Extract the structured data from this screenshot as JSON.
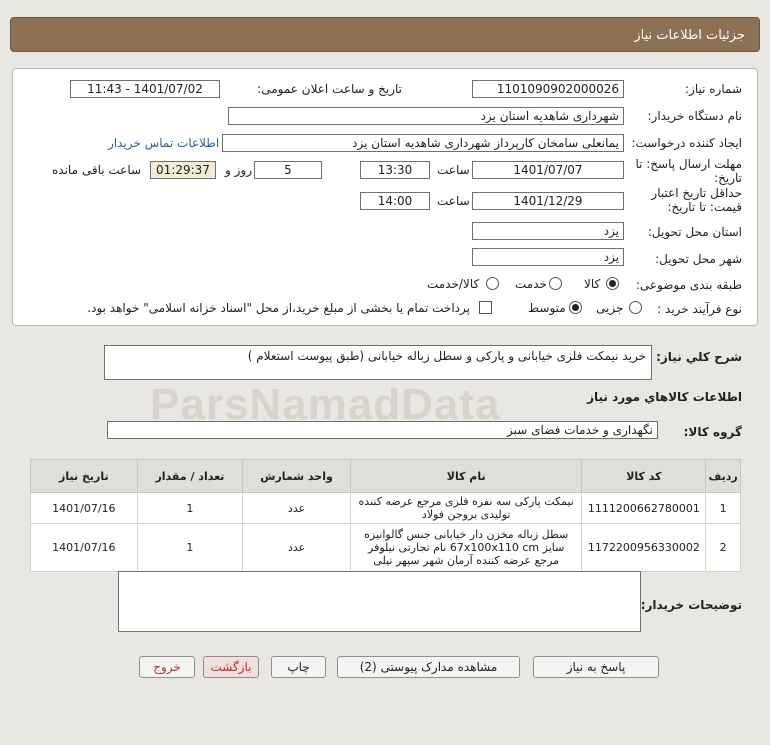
{
  "header": {
    "title": "جزئیات اطلاعات نیاز"
  },
  "form": {
    "need_number_label": "شماره نیاز:",
    "need_number": "1101090902000026",
    "announce_label": "تاریخ و ساعت اعلان عمومی:",
    "announce_value": "1401/07/02 - 11:43",
    "buyer_org_label": "نام دستگاه خریدار:",
    "buyer_org": "شهرداری شاهدیه استان یزد",
    "requester_label": "ایجاد کننده درخواست:",
    "requester": "یمانعلی سامخان کارپرداز شهرداری شاهدیه استان یزد",
    "contact_link": "اطلاعات تماس خریدار",
    "reply_deadline_label": "مهلت ارسال پاسخ: تا تاریخ:",
    "reply_date": "1401/07/07",
    "time_label": "ساعت",
    "reply_time": "13:30",
    "days": "5",
    "days_label": "روز و",
    "remaining_time": "01:29:37",
    "remaining_label": "ساعت باقی مانده",
    "min_validity_label": "حداقل تاریخ اعتبار قیمت: تا تاریخ:",
    "validity_date": "1401/12/29",
    "validity_time_label": "ساعت",
    "validity_time": "14:00",
    "delivery_province_label": "استان محل تحویل:",
    "delivery_province": "یزد",
    "delivery_city_label": "شهر محل تحویل:",
    "delivery_city": "یزد",
    "category_label": "طبقه بندی موضوعی:",
    "category_options": [
      "کالا",
      "خدمت",
      "کالا/خدمت"
    ],
    "purchase_type_label": "نوع فرآیند خرید :",
    "purchase_options": [
      "جزیی",
      "متوسط"
    ],
    "payment_note": "پرداخت تمام یا بخشی از مبلغ خرید،از محل \"اسناد خزانه اسلامی\" خواهد بود."
  },
  "description": {
    "label": "شرح کلي نياز:",
    "value": "خرید نیمکت فلزی خیابانی و پارکی و سطل زباله خیابانی (طبق پیوست استعلام )"
  },
  "goods_section_title": "اطلاعات کالاهاي مورد نياز",
  "goods_group": {
    "label": "گروه کالا:",
    "value": "نگهداری و خدمات فضای سبز"
  },
  "watermark": "ParsNamadData",
  "table": {
    "headers": [
      "ردیف",
      "کد کالا",
      "نام کالا",
      "واحد شمارش",
      "تعداد / مقدار",
      "تاریخ نیاز"
    ],
    "rows": [
      [
        "1",
        "1111200662780001",
        "نیمکت پارکی سه نفره فلزی مرجع عرضه کننده تولیدی بروجن فولاد",
        "عدد",
        "1",
        "1401/07/16"
      ],
      [
        "2",
        "1172200956330002",
        "سطل زباله مخزن دار خیابانی جنس گالوانیزه سایز 67x100x110 cm نام تجارتی نیلوفر مرجع عرضه کننده آرمان شهر سپهر نیلی",
        "عدد",
        "1",
        "1401/07/16"
      ]
    ]
  },
  "buyer_notes": {
    "label": "توضیحات خریدار:",
    "value": ""
  },
  "buttons": {
    "reply": "پاسخ به نیاز",
    "attachments": "مشاهده مدارک پیوستی (2)",
    "print": "چاپ",
    "back": "بازگشت",
    "exit": "خروج"
  }
}
